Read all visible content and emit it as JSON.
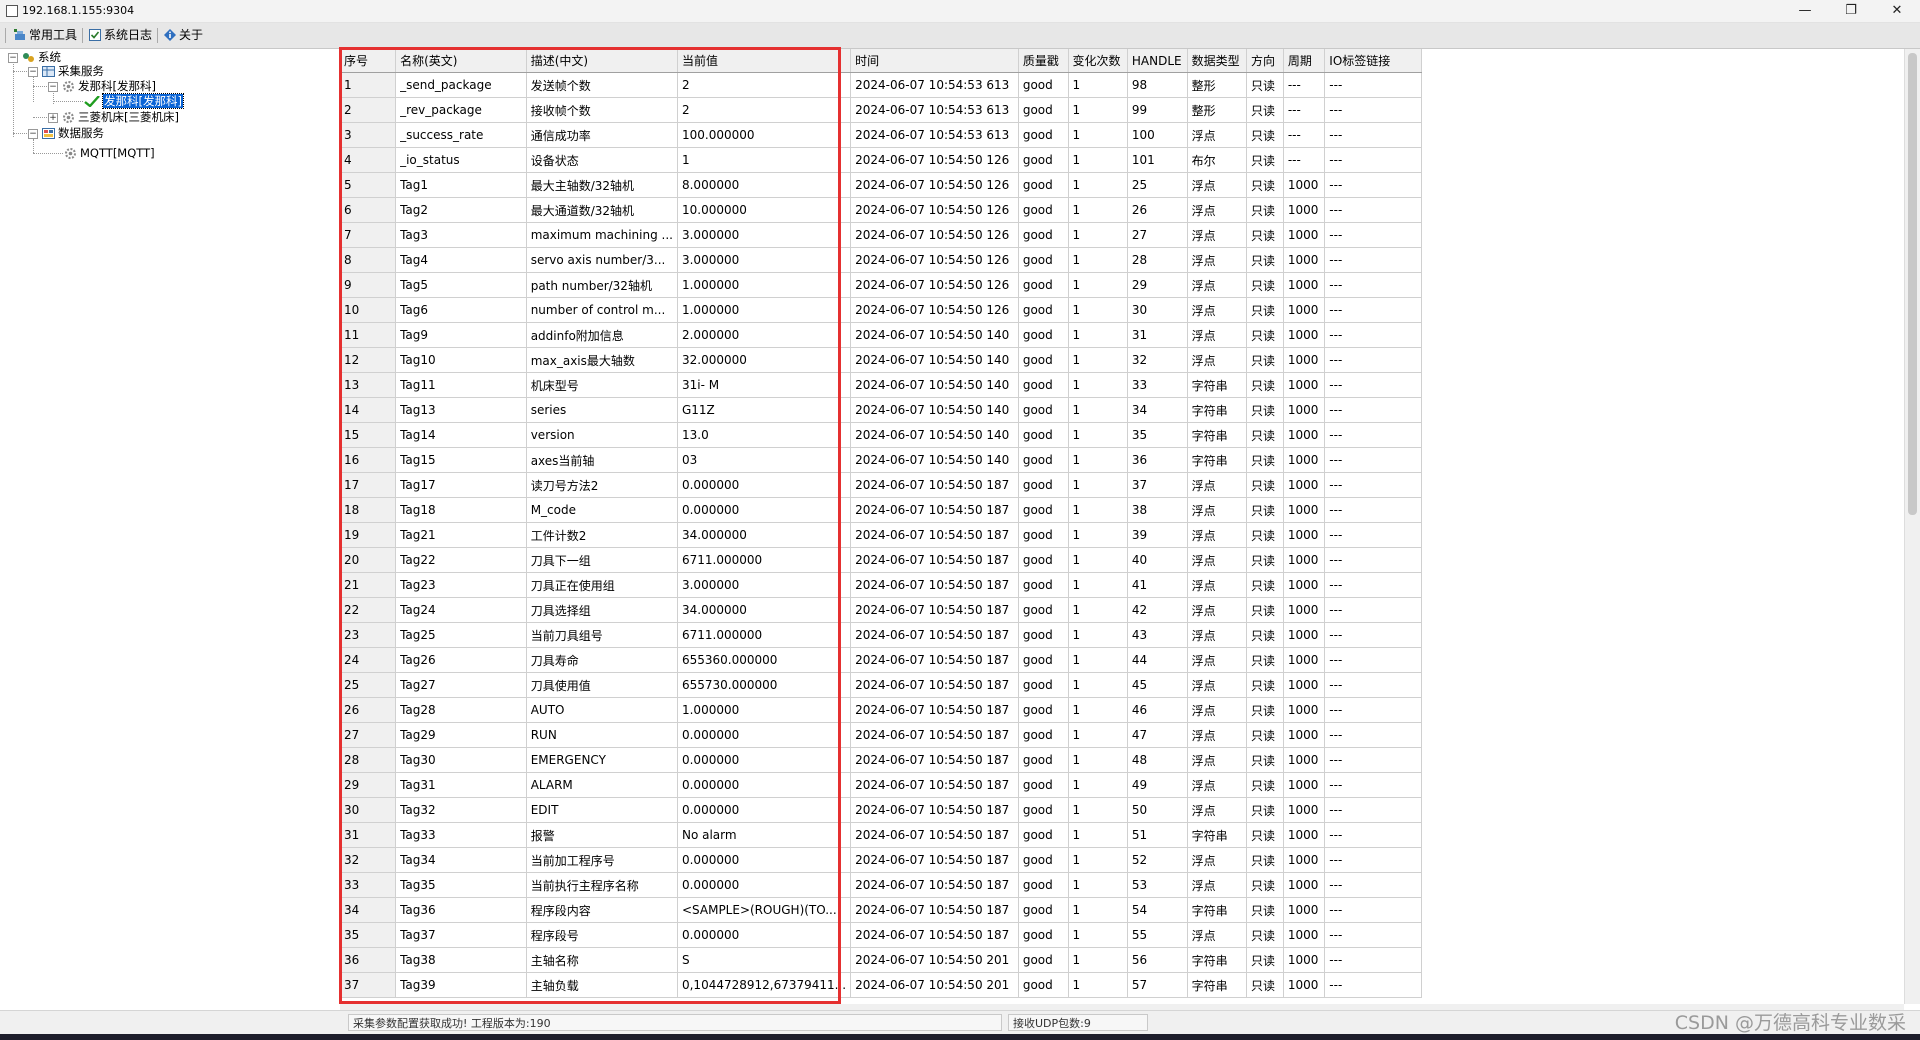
{
  "window": {
    "title": "192.168.1.155:9304",
    "controls": {
      "minimize": "—",
      "maximize": "❐",
      "close": "✕"
    }
  },
  "toolbar": {
    "common_tools": "常用工具",
    "system_log": "系统日志",
    "about": "关于"
  },
  "tree": {
    "root": "系统",
    "collection_service": "采集服务",
    "fanuc_group": "发那科[发那科]",
    "fanuc_device": "发那科[发那科]",
    "mitsubishi": "三菱机床[三菱机床]",
    "data_service": "数据服务",
    "mqtt": "MQTT[MQTT]"
  },
  "table": {
    "headers": [
      "序号",
      "名称(英文)",
      "描述(中文)",
      "当前值",
      "时间",
      "质量戳",
      "变化次数",
      "HANDLE",
      "数据类型",
      "方向",
      "周期",
      "IO标签链接"
    ],
    "rows": [
      [
        "1",
        "_send_package",
        "发送帧个数",
        "2",
        "2024-06-07 10:54:53 613",
        "good",
        "1",
        "98",
        "整形",
        "只读",
        "---",
        "---"
      ],
      [
        "2",
        "_rev_package",
        "接收帧个数",
        "2",
        "2024-06-07 10:54:53 613",
        "good",
        "1",
        "99",
        "整形",
        "只读",
        "---",
        "---"
      ],
      [
        "3",
        "_success_rate",
        "通信成功率",
        "100.000000",
        "2024-06-07 10:54:53 613",
        "good",
        "1",
        "100",
        "浮点",
        "只读",
        "---",
        "---"
      ],
      [
        "4",
        "_io_status",
        "设备状态",
        "1",
        "2024-06-07 10:54:50 126",
        "good",
        "1",
        "101",
        "布尔",
        "只读",
        "---",
        "---"
      ],
      [
        "5",
        "Tag1",
        "最大主轴数/32轴机",
        "8.000000",
        "2024-06-07 10:54:50 126",
        "good",
        "1",
        "25",
        "浮点",
        "只读",
        "1000",
        "---"
      ],
      [
        "6",
        "Tag2",
        "最大通道数/32轴机",
        "10.000000",
        "2024-06-07 10:54:50 126",
        "good",
        "1",
        "26",
        "浮点",
        "只读",
        "1000",
        "---"
      ],
      [
        "7",
        "Tag3",
        "maximum machining ...",
        "3.000000",
        "2024-06-07 10:54:50 126",
        "good",
        "1",
        "27",
        "浮点",
        "只读",
        "1000",
        "---"
      ],
      [
        "8",
        "Tag4",
        "servo axis number/3...",
        "3.000000",
        "2024-06-07 10:54:50 126",
        "good",
        "1",
        "28",
        "浮点",
        "只读",
        "1000",
        "---"
      ],
      [
        "9",
        "Tag5",
        "path number/32轴机",
        "1.000000",
        "2024-06-07 10:54:50 126",
        "good",
        "1",
        "29",
        "浮点",
        "只读",
        "1000",
        "---"
      ],
      [
        "10",
        "Tag6",
        "number of control m...",
        "1.000000",
        "2024-06-07 10:54:50 126",
        "good",
        "1",
        "30",
        "浮点",
        "只读",
        "1000",
        "---"
      ],
      [
        "11",
        "Tag9",
        "addinfo附加信息",
        "2.000000",
        "2024-06-07 10:54:50 140",
        "good",
        "1",
        "31",
        "浮点",
        "只读",
        "1000",
        "---"
      ],
      [
        "12",
        "Tag10",
        "max_axis最大轴数",
        "32.000000",
        "2024-06-07 10:54:50 140",
        "good",
        "1",
        "32",
        "浮点",
        "只读",
        "1000",
        "---"
      ],
      [
        "13",
        "Tag11",
        "机床型号",
        "31i- M",
        "2024-06-07 10:54:50 140",
        "good",
        "1",
        "33",
        "字符串",
        "只读",
        "1000",
        "---"
      ],
      [
        "14",
        "Tag13",
        "series",
        "G11Z",
        "2024-06-07 10:54:50 140",
        "good",
        "1",
        "34",
        "字符串",
        "只读",
        "1000",
        "---"
      ],
      [
        "15",
        "Tag14",
        "version",
        "13.0",
        "2024-06-07 10:54:50 140",
        "good",
        "1",
        "35",
        "字符串",
        "只读",
        "1000",
        "---"
      ],
      [
        "16",
        "Tag15",
        "axes当前轴",
        "03",
        "2024-06-07 10:54:50 140",
        "good",
        "1",
        "36",
        "字符串",
        "只读",
        "1000",
        "---"
      ],
      [
        "17",
        "Tag17",
        "读刀号方法2",
        "0.000000",
        "2024-06-07 10:54:50 187",
        "good",
        "1",
        "37",
        "浮点",
        "只读",
        "1000",
        "---"
      ],
      [
        "18",
        "Tag18",
        "M_code",
        "0.000000",
        "2024-06-07 10:54:50 187",
        "good",
        "1",
        "38",
        "浮点",
        "只读",
        "1000",
        "---"
      ],
      [
        "19",
        "Tag21",
        "工件计数2",
        "34.000000",
        "2024-06-07 10:54:50 187",
        "good",
        "1",
        "39",
        "浮点",
        "只读",
        "1000",
        "---"
      ],
      [
        "20",
        "Tag22",
        "刀具下一组",
        "6711.000000",
        "2024-06-07 10:54:50 187",
        "good",
        "1",
        "40",
        "浮点",
        "只读",
        "1000",
        "---"
      ],
      [
        "21",
        "Tag23",
        "刀具正在使用组",
        "3.000000",
        "2024-06-07 10:54:50 187",
        "good",
        "1",
        "41",
        "浮点",
        "只读",
        "1000",
        "---"
      ],
      [
        "22",
        "Tag24",
        "刀具选择组",
        "34.000000",
        "2024-06-07 10:54:50 187",
        "good",
        "1",
        "42",
        "浮点",
        "只读",
        "1000",
        "---"
      ],
      [
        "23",
        "Tag25",
        "当前刀具组号",
        "6711.000000",
        "2024-06-07 10:54:50 187",
        "good",
        "1",
        "43",
        "浮点",
        "只读",
        "1000",
        "---"
      ],
      [
        "24",
        "Tag26",
        "刀具寿命",
        "655360.000000",
        "2024-06-07 10:54:50 187",
        "good",
        "1",
        "44",
        "浮点",
        "只读",
        "1000",
        "---"
      ],
      [
        "25",
        "Tag27",
        "刀具使用值",
        "655730.000000",
        "2024-06-07 10:54:50 187",
        "good",
        "1",
        "45",
        "浮点",
        "只读",
        "1000",
        "---"
      ],
      [
        "26",
        "Tag28",
        "AUTO",
        "1.000000",
        "2024-06-07 10:54:50 187",
        "good",
        "1",
        "46",
        "浮点",
        "只读",
        "1000",
        "---"
      ],
      [
        "27",
        "Tag29",
        "RUN",
        "0.000000",
        "2024-06-07 10:54:50 187",
        "good",
        "1",
        "47",
        "浮点",
        "只读",
        "1000",
        "---"
      ],
      [
        "28",
        "Tag30",
        "EMERGENCY",
        "0.000000",
        "2024-06-07 10:54:50 187",
        "good",
        "1",
        "48",
        "浮点",
        "只读",
        "1000",
        "---"
      ],
      [
        "29",
        "Tag31",
        "ALARM",
        "0.000000",
        "2024-06-07 10:54:50 187",
        "good",
        "1",
        "49",
        "浮点",
        "只读",
        "1000",
        "---"
      ],
      [
        "30",
        "Tag32",
        "EDIT",
        "0.000000",
        "2024-06-07 10:54:50 187",
        "good",
        "1",
        "50",
        "浮点",
        "只读",
        "1000",
        "---"
      ],
      [
        "31",
        "Tag33",
        "报警",
        "No alarm",
        "2024-06-07 10:54:50 187",
        "good",
        "1",
        "51",
        "字符串",
        "只读",
        "1000",
        "---"
      ],
      [
        "32",
        "Tag34",
        "当前加工程序号",
        "0.000000",
        "2024-06-07 10:54:50 187",
        "good",
        "1",
        "52",
        "浮点",
        "只读",
        "1000",
        "---"
      ],
      [
        "33",
        "Tag35",
        "当前执行主程序名称",
        "0.000000",
        "2024-06-07 10:54:50 187",
        "good",
        "1",
        "53",
        "浮点",
        "只读",
        "1000",
        "---"
      ],
      [
        "34",
        "Tag36",
        "程序段内容",
        "<SAMPLE>(ROUGH)(TO...",
        "2024-06-07 10:54:50 187",
        "good",
        "1",
        "54",
        "字符串",
        "只读",
        "1000",
        "---"
      ],
      [
        "35",
        "Tag37",
        "程序段号",
        "0.000000",
        "2024-06-07 10:54:50 187",
        "good",
        "1",
        "55",
        "浮点",
        "只读",
        "1000",
        "---"
      ],
      [
        "36",
        "Tag38",
        "主轴名称",
        "S",
        "2024-06-07 10:54:50 201",
        "good",
        "1",
        "56",
        "字符串",
        "只读",
        "1000",
        "---"
      ],
      [
        "37",
        "Tag39",
        "主轴负载",
        "0,1044728912,67379411...",
        "2024-06-07 10:54:50 201",
        "good",
        "1",
        "57",
        "字符串",
        "只读",
        "1000",
        "---"
      ]
    ]
  },
  "status": {
    "message": "采集参数配置获取成功! 工程版本为:190",
    "udp": "接收UDP包数:9"
  },
  "watermark": "CSDN @万德高科专业数采"
}
